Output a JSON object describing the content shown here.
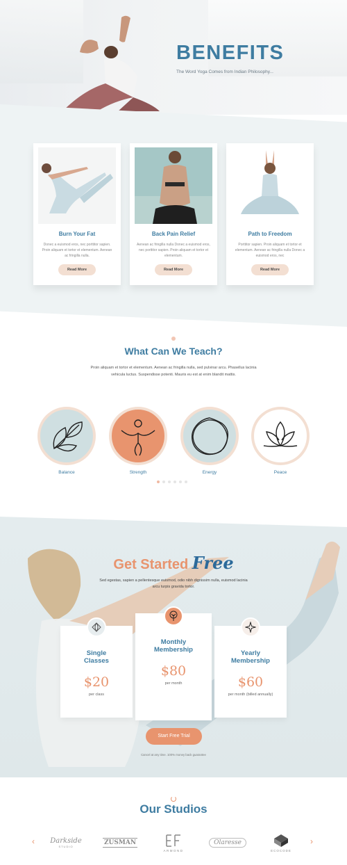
{
  "hero": {
    "title": "BENEFITS",
    "subtitle": "The Word Yoga Comes from Indian Philosophy..."
  },
  "benefits": {
    "cards": [
      {
        "title": "Burn Your Fat",
        "text": "Donec a euismod eros, nec porttitor sapien. Proin aliquam et tortor et elementum. Aenean ac fringilla nulla.",
        "button": "Read More"
      },
      {
        "title": "Back Pain Relief",
        "text": "Aenean ac fringilla nulla Donec a euismod eros, nec porttitor sapien. Proin aliquam et tortor et elementum.",
        "button": "Read More"
      },
      {
        "title": "Path to Freedom",
        "text": "Porttitor sapien. Proin aliquam et tortor et elementum. Aenean ac fringilla nulla Donec a euismod eros, nec",
        "button": "Read More"
      }
    ]
  },
  "teach": {
    "title": "What Can We Teach?",
    "text": "Proin aliquam et tortor et elementum. Aenean ac fringilla nulla, sed pulvinar arcu. Phasellus lacinia vehicula luctus. Suspendisse potenti. Mauris eu est at enim blandit mattis.",
    "items": [
      {
        "label": "Balance",
        "icon": "leaves-icon"
      },
      {
        "label": "Strength",
        "icon": "yoga-figure-icon"
      },
      {
        "label": "Energy",
        "icon": "wavy-circle-icon"
      },
      {
        "label": "Peace",
        "icon": "lotus-icon"
      }
    ],
    "pager_count": 6,
    "pager_active": 1
  },
  "get_started": {
    "title": "Get Started",
    "title_accent": "Free",
    "text": "Sed egestas, sapien a pellentesque euismod, odio nibh dignissim nulla, euismod lacinia arcu turpis gravida tortor.",
    "plans": [
      {
        "name_line1": "Single",
        "name_line2": "Classes",
        "price": "$20",
        "period": "per class"
      },
      {
        "name_line1": "Monthly",
        "name_line2": "Membership",
        "price": "$80",
        "period": "per month"
      },
      {
        "name_line1": "Yearly",
        "name_line2": "Membership",
        "price": "$60",
        "period": "per month (billed annually)"
      }
    ],
    "button": "Start Free Trial",
    "note": "Cancel at any time. 100% money back guarantee"
  },
  "studios": {
    "title": "Our Studios",
    "logos": [
      {
        "name": "Darkside",
        "sub": "STUDIO"
      },
      {
        "name": "ZUSMAN",
        "sub": ""
      },
      {
        "name": "ARMOND",
        "sub": ""
      },
      {
        "name": "Olaresse",
        "sub": ""
      },
      {
        "name": "ECOCODE",
        "sub": ""
      }
    ],
    "prev": "‹",
    "next": "›"
  },
  "colors": {
    "blue": "#3e7ca1",
    "peach": "#e8946e",
    "peach_light": "#f3dfd2",
    "circle_bg": "#cfdfe1"
  }
}
